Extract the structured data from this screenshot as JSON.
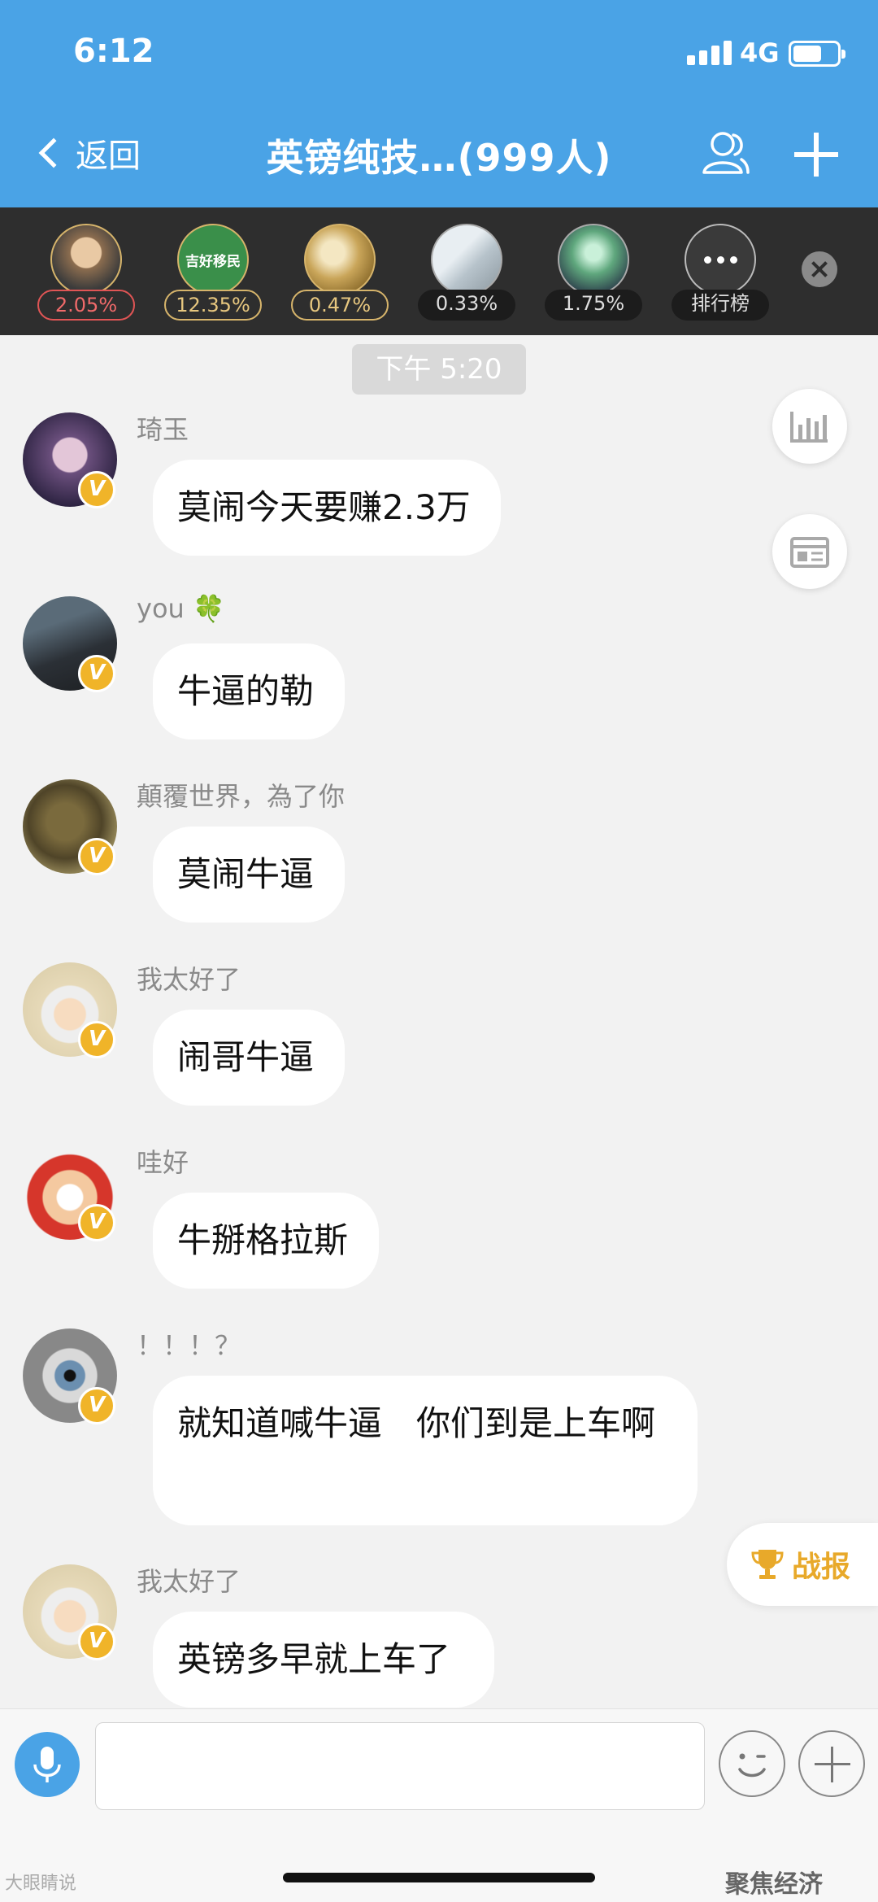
{
  "status_bar": {
    "time": "6:12",
    "network": "4G"
  },
  "header": {
    "back_label": "返回",
    "title": "英镑纯技…(999人)"
  },
  "ranking": {
    "items": [
      {
        "percent": "2.05%",
        "style": "red",
        "avatar": "monk-avatar"
      },
      {
        "percent": "12.35%",
        "style": "gold",
        "avatar": "jihao-immigration-avatar",
        "avatar_text": "吉好移民"
      },
      {
        "percent": "0.47%",
        "style": "gold",
        "avatar": "gold-map-avatar"
      },
      {
        "percent": "0.33%",
        "style": "dark",
        "avatar": "stairs-avatar"
      },
      {
        "percent": "1.75%",
        "style": "dark",
        "avatar": "aurora-avatar"
      }
    ],
    "more_label": "排行榜"
  },
  "time_divider": "下午 5:20",
  "messages": [
    {
      "sender": "琦玉",
      "text": "莫闹今天要赚2.3万",
      "avatar": "saitama-avatar"
    },
    {
      "sender": "you 🍀",
      "text": "牛逼的勒",
      "avatar": "suit-man-avatar"
    },
    {
      "sender": "顛覆世界，為了你",
      "text": "莫闹牛逼",
      "avatar": "ape-warrior-avatar"
    },
    {
      "sender": "我太好了",
      "text": "闹哥牛逼",
      "avatar": "cartoon-kid-avatar"
    },
    {
      "sender": "哇好",
      "text": "牛掰格拉斯",
      "avatar": "wangzai-avatar"
    },
    {
      "sender": "！！！？",
      "text": "就知道喊牛逼　你们到是上车啊",
      "avatar": "eye-avatar"
    },
    {
      "sender": "我太好了",
      "text": "英镑多早就上车了",
      "avatar": "cartoon-kid-avatar"
    }
  ],
  "badge_glyph": "V",
  "battle_report_label": "战报",
  "input": {
    "value": "",
    "placeholder": ""
  },
  "watermarks": {
    "left": "大眼睛说",
    "right": "聚焦经济"
  },
  "colors": {
    "header": "#4aa3e6",
    "strip": "#2e2e2e",
    "badge": "#f0b429",
    "battle": "#e8a92a"
  }
}
